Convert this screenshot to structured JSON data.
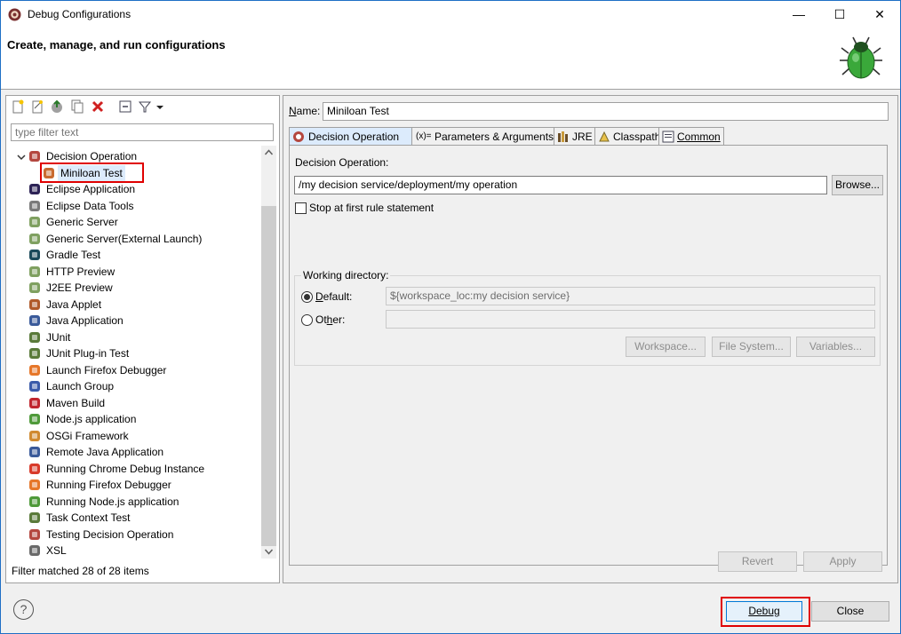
{
  "window": {
    "title": "Debug Configurations",
    "minimize": "—",
    "maximize": "☐",
    "close": "✕"
  },
  "banner": {
    "title": "Create, manage, and run configurations",
    "icon": "bug-icon"
  },
  "left": {
    "filter_placeholder": "type filter text",
    "filter_status": "Filter matched 28 of 28 items",
    "tree": [
      {
        "label": "Decision Operation",
        "icon": "decision-operation-icon",
        "expanded": true,
        "level": 0
      },
      {
        "label": "Miniloan Test",
        "icon": "decision-config-icon",
        "level": 1,
        "selected": true
      },
      {
        "label": "Eclipse Application",
        "icon": "eclipse-icon",
        "level": 0
      },
      {
        "label": "Eclipse Data Tools",
        "icon": "database-icon",
        "level": 0
      },
      {
        "label": "Generic Server",
        "icon": "server-icon",
        "level": 0
      },
      {
        "label": "Generic Server(External Launch)",
        "icon": "server-icon",
        "level": 0
      },
      {
        "label": "Gradle Test",
        "icon": "gradle-icon",
        "level": 0
      },
      {
        "label": "HTTP Preview",
        "icon": "server-icon",
        "level": 0
      },
      {
        "label": "J2EE Preview",
        "icon": "server-icon",
        "level": 0
      },
      {
        "label": "Java Applet",
        "icon": "java-applet-icon",
        "level": 0
      },
      {
        "label": "Java Application",
        "icon": "java-app-icon",
        "level": 0
      },
      {
        "label": "JUnit",
        "icon": "junit-icon",
        "level": 0
      },
      {
        "label": "JUnit Plug-in Test",
        "icon": "junit-plugin-icon",
        "level": 0
      },
      {
        "label": "Launch Firefox Debugger",
        "icon": "firefox-icon",
        "level": 0
      },
      {
        "label": "Launch Group",
        "icon": "launch-group-icon",
        "level": 0
      },
      {
        "label": "Maven Build",
        "icon": "maven-icon",
        "level": 0
      },
      {
        "label": "Node.js application",
        "icon": "nodejs-icon",
        "level": 0
      },
      {
        "label": "OSGi Framework",
        "icon": "osgi-icon",
        "level": 0
      },
      {
        "label": "Remote Java Application",
        "icon": "remote-java-icon",
        "level": 0
      },
      {
        "label": "Running Chrome Debug Instance",
        "icon": "chrome-icon",
        "level": 0
      },
      {
        "label": "Running Firefox Debugger",
        "icon": "firefox-icon",
        "level": 0
      },
      {
        "label": "Running Node.js application",
        "icon": "nodejs-icon",
        "level": 0
      },
      {
        "label": "Task Context Test",
        "icon": "task-context-icon",
        "level": 0
      },
      {
        "label": "Testing Decision Operation",
        "icon": "testing-decision-icon",
        "level": 0
      },
      {
        "label": "XSL",
        "icon": "xsl-icon",
        "level": 0
      }
    ]
  },
  "right": {
    "name_label": "Name:",
    "name_value": "Miniloan Test",
    "tabs": [
      {
        "label": "Decision Operation",
        "active": true
      },
      {
        "label": "Parameters & Arguments",
        "prefix": "(x)="
      },
      {
        "label": "JRE"
      },
      {
        "label": "Classpath"
      },
      {
        "label": "Common"
      }
    ],
    "decision_operation_label": "Decision Operation:",
    "decision_operation_value": "/my decision service/deployment/my operation",
    "browse_label": "Browse...",
    "stop_first_rule_label": "Stop at first rule statement",
    "working_directory_label": "Working directory:",
    "default_label": "Default:",
    "default_value": "${workspace_loc:my decision service}",
    "other_label": "Other:",
    "workspace_button": "Workspace...",
    "file_system_button": "File System...",
    "variables_button": "Variables...",
    "revert_button": "Revert",
    "apply_button": "Apply"
  },
  "footer": {
    "debug_button": "Debug",
    "close_button": "Close",
    "help_icon": "?"
  },
  "colors": {
    "highlight": "#e00000",
    "selection": "#dcebfc",
    "frame": "#1f6fc5"
  }
}
